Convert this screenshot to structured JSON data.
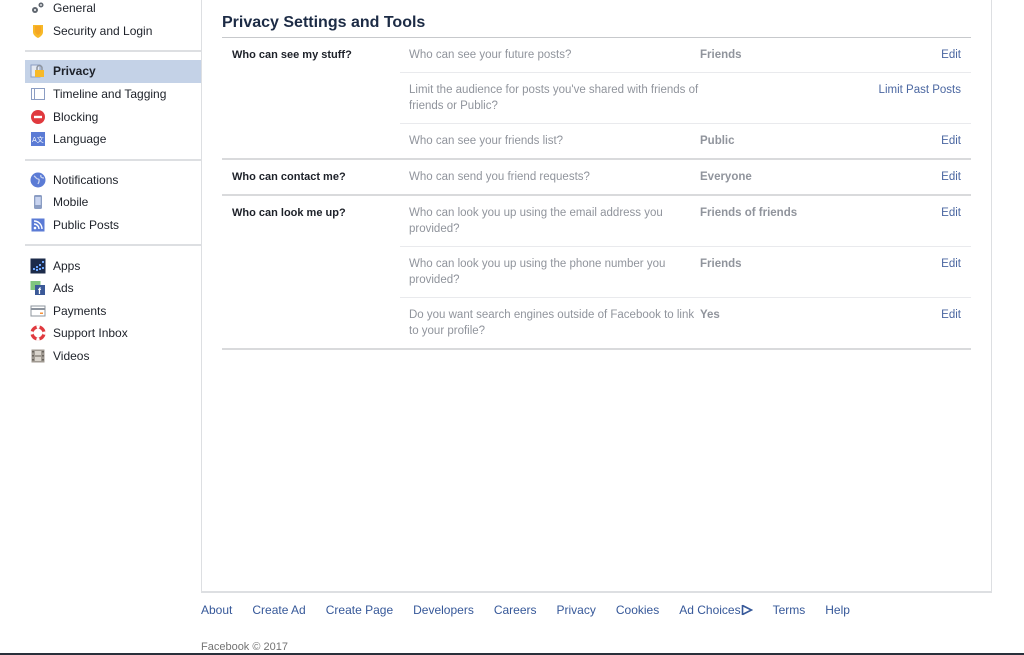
{
  "sidebar": {
    "groups": [
      [
        {
          "label": "General",
          "icon": "gears-icon"
        },
        {
          "label": "Security and Login",
          "icon": "shield-icon"
        }
      ],
      [
        {
          "label": "Privacy",
          "icon": "lock-icon",
          "active": true
        },
        {
          "label": "Timeline and Tagging",
          "icon": "timeline-icon"
        },
        {
          "label": "Blocking",
          "icon": "block-icon"
        },
        {
          "label": "Language",
          "icon": "language-icon"
        }
      ],
      [
        {
          "label": "Notifications",
          "icon": "globe-icon"
        },
        {
          "label": "Mobile",
          "icon": "mobile-icon"
        },
        {
          "label": "Public Posts",
          "icon": "rss-icon"
        }
      ],
      [
        {
          "label": "Apps",
          "icon": "apps-icon"
        },
        {
          "label": "Ads",
          "icon": "ads-icon"
        },
        {
          "label": "Payments",
          "icon": "card-icon"
        },
        {
          "label": "Support Inbox",
          "icon": "lifebuoy-icon"
        },
        {
          "label": "Videos",
          "icon": "film-icon"
        }
      ]
    ]
  },
  "main": {
    "title": "Privacy Settings and Tools",
    "sections": [
      {
        "label": "Who can see my stuff?",
        "rows": [
          {
            "question": "Who can see your future posts?",
            "value": "Friends",
            "action": "Edit"
          },
          {
            "question": "Limit the audience for posts you've shared with friends of friends or Public?",
            "value": "",
            "action": "Limit Past Posts"
          },
          {
            "question": "Who can see your friends list?",
            "value": "Public",
            "action": "Edit"
          }
        ]
      },
      {
        "label": "Who can contact me?",
        "rows": [
          {
            "question": "Who can send you friend requests?",
            "value": "Everyone",
            "action": "Edit"
          }
        ]
      },
      {
        "label": "Who can look me up?",
        "rows": [
          {
            "question": "Who can look you up using the email address you provided?",
            "value": "Friends of friends",
            "action": "Edit"
          },
          {
            "question": "Who can look you up using the phone number you provided?",
            "value": "Friends",
            "action": "Edit"
          },
          {
            "question": "Do you want search engines outside of Facebook to link to your profile?",
            "value": "Yes",
            "action": "Edit"
          }
        ]
      }
    ]
  },
  "footer": {
    "links": [
      "About",
      "Create Ad",
      "Create Page",
      "Developers",
      "Careers",
      "Privacy",
      "Cookies",
      "Ad Choices",
      "Terms",
      "Help"
    ],
    "copyright": "Facebook © 2017"
  },
  "colors": {
    "link": "#365899",
    "active_bg": "#c4d2e7",
    "title": "#1c2b45",
    "muted": "#90949c"
  }
}
